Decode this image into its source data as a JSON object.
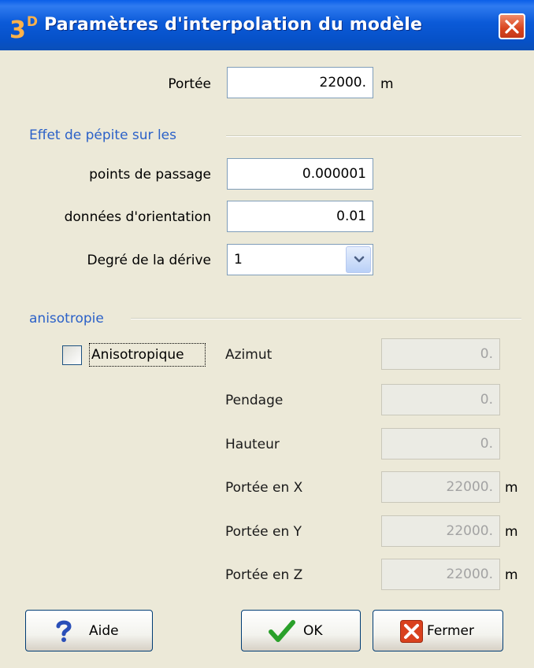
{
  "window": {
    "title": "Paramètres d'interpolation du modèle",
    "logo": {
      "text": "3",
      "superscript": "D"
    }
  },
  "range": {
    "label": "Portée",
    "value": "22000.",
    "unit": "m"
  },
  "nugget_section": {
    "title": "Effet de pépite sur les",
    "waypoints": {
      "label": "points de passage",
      "value": "0.000001"
    },
    "orientation": {
      "label": "données d'orientation",
      "value": "0.01"
    },
    "drift": {
      "label": "Degré de la dérive",
      "selected": "1"
    }
  },
  "anisotropy_section": {
    "title": "anisotropie",
    "checkbox": {
      "label": "Anisotropique",
      "checked": false
    },
    "azimuth": {
      "label": "Azimut",
      "value": "0."
    },
    "dip": {
      "label": "Pendage",
      "value": "0."
    },
    "height": {
      "label": "Hauteur",
      "value": "0."
    },
    "range_x": {
      "label": "Portée en X",
      "value": "22000.",
      "unit": "m"
    },
    "range_y": {
      "label": "Portée en Y",
      "value": "22000.",
      "unit": "m"
    },
    "range_z": {
      "label": "Portée en Z",
      "value": "22000.",
      "unit": "m"
    }
  },
  "buttons": {
    "help": "Aide",
    "ok": "OK",
    "close": "Fermer"
  },
  "colors": {
    "title_bar": "#0a5ee8",
    "section_title": "#2b61c8",
    "window_bg": "#ece9d8",
    "disabled_text": "#a3a3a3"
  }
}
